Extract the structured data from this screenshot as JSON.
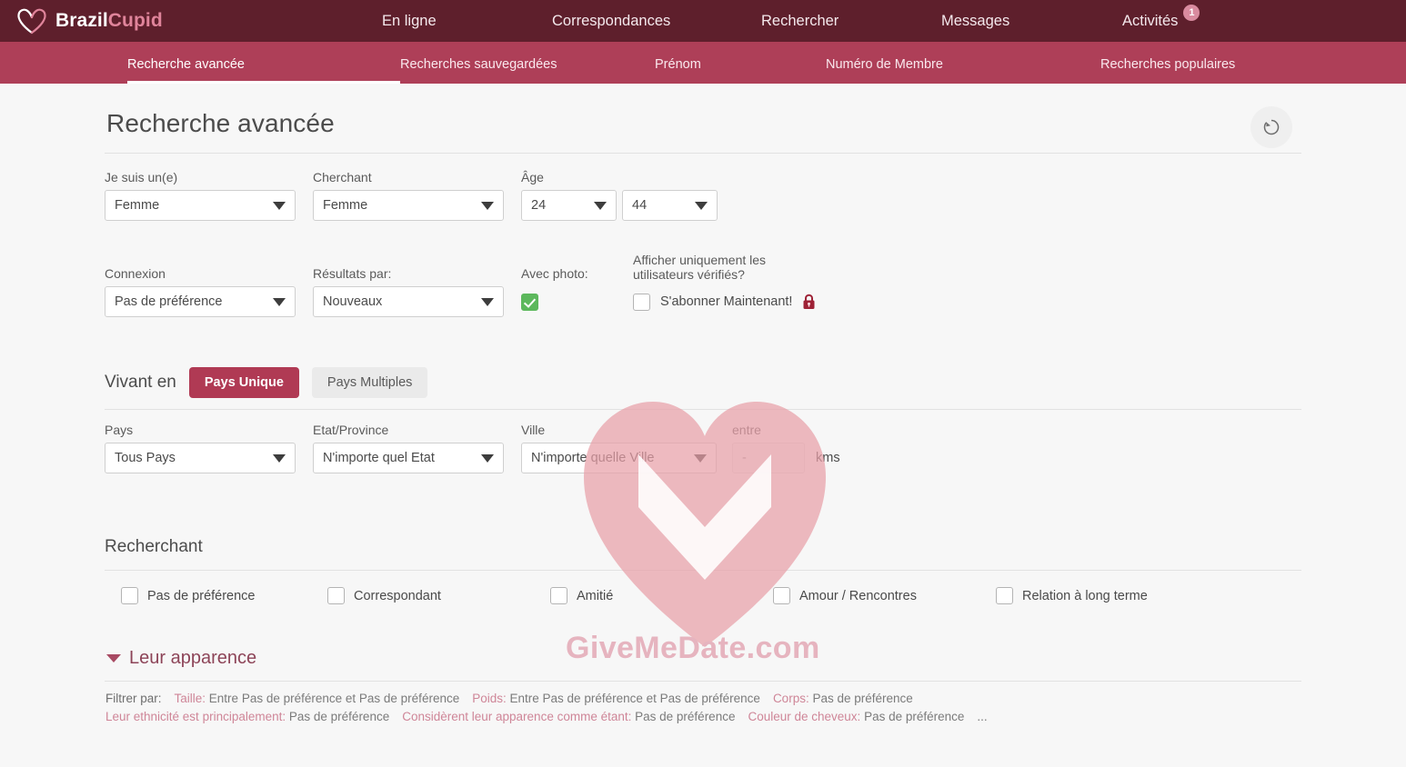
{
  "brand": {
    "name_part1": "Brazil",
    "name_part2": "Cupid",
    "heart_icon": "heart-outline-icon"
  },
  "topnav": {
    "items": [
      {
        "label": "En ligne"
      },
      {
        "label": "Correspondances"
      },
      {
        "label": "Rechercher"
      },
      {
        "label": "Messages"
      },
      {
        "label": "Activités",
        "badge": "1"
      }
    ]
  },
  "subnav": {
    "items": [
      {
        "label": "Recherche avancée",
        "active": true
      },
      {
        "label": "Recherches sauvegardées",
        "active": false
      },
      {
        "label": "Prénom",
        "active": false
      },
      {
        "label": "Numéro de Membre",
        "active": false
      },
      {
        "label": "Recherches populaires",
        "active": false
      }
    ]
  },
  "page": {
    "title": "Recherche avancée",
    "reset_icon": "reset-circular-arrow-icon"
  },
  "basic": {
    "gender_label": "Je suis un(e)",
    "gender_value": "Femme",
    "seeking_label": "Cherchant",
    "seeking_value": "Femme",
    "age_label": "Âge",
    "age_min": "24",
    "age_max": "44",
    "connection_label": "Connexion",
    "connection_value": "Pas de préférence",
    "results_label": "Résultats par:",
    "results_value": "Nouveaux",
    "photo_label": "Avec photo:",
    "photo_checked": true,
    "verified_label_line1": "Afficher uniquement les",
    "verified_label_line2": "utilisateurs vérifiés?",
    "subscribe_label": "S'abonner Maintenant!",
    "subscribe_checked": false,
    "lock_icon": "lock-icon"
  },
  "location": {
    "section_title": "Vivant en",
    "single_country_btn": "Pays Unique",
    "multi_country_btn": "Pays Multiples",
    "country_label": "Pays",
    "country_value": "Tous Pays",
    "state_label": "Etat/Province",
    "state_value": "N'importe quel Etat",
    "city_label": "Ville",
    "city_value": "N'importe quelle Ville",
    "between_label": "entre",
    "between_value": "-",
    "kms_label": "kms"
  },
  "seeking": {
    "section_title": "Recherchant",
    "options": [
      {
        "label": "Pas de préférence",
        "checked": false
      },
      {
        "label": "Correspondant",
        "checked": false
      },
      {
        "label": "Amitié",
        "checked": false
      },
      {
        "label": "Amour / Rencontres",
        "checked": false
      },
      {
        "label": "Relation à long terme",
        "checked": false
      }
    ]
  },
  "appearance": {
    "chevron_icon": "chevron-down-icon",
    "title": "Leur apparence",
    "filter_prefix": "Filtrer par:",
    "filters_line1": [
      {
        "key": "Taille:",
        "value": "Entre Pas de préférence et Pas de préférence"
      },
      {
        "key": "Poids:",
        "value": "Entre Pas de préférence et Pas de préférence"
      },
      {
        "key": "Corps:",
        "value": "Pas de préférence"
      }
    ],
    "filters_line2": [
      {
        "key": "Leur ethnicité est principalement:",
        "value": "Pas de préférence"
      },
      {
        "key": "Considèrent leur apparence comme étant:",
        "value": "Pas de préférence"
      },
      {
        "key": "Couleur de cheveux:",
        "value": "Pas de préférence"
      }
    ],
    "more": "..."
  },
  "watermark": {
    "text": "GiveMeDate.com",
    "heart_icon": "watermark-heart-icon"
  },
  "colors": {
    "topbar": "#5e1f2c",
    "subbar": "#ae3f58",
    "accent": "#b03a54",
    "brand_pink": "#e0849b",
    "check_green": "#5cb85c",
    "page_bg": "#f7f7f7"
  }
}
